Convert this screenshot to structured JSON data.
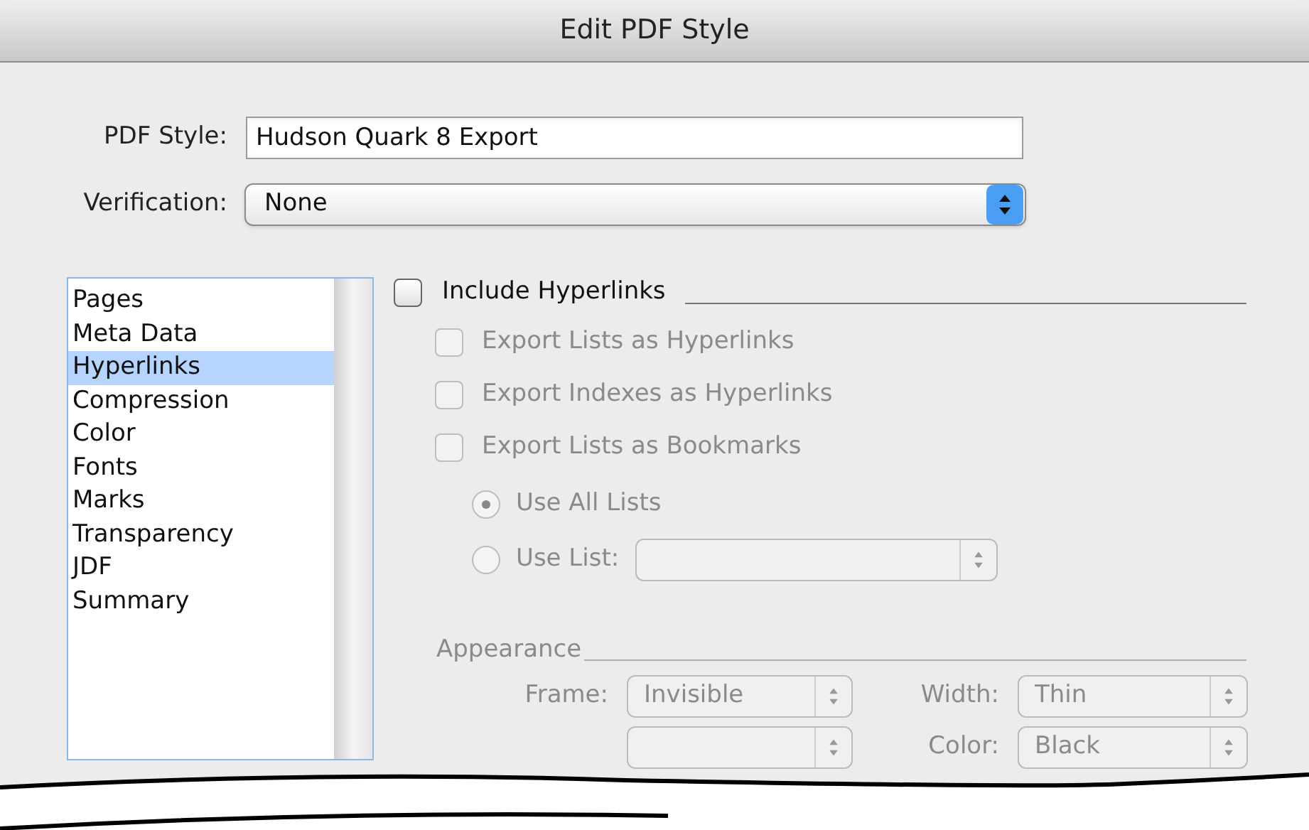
{
  "window": {
    "title": "Edit PDF Style"
  },
  "pdf_style": {
    "label": "PDF Style:",
    "value": "Hudson Quark 8 Export"
  },
  "verification": {
    "label": "Verification:",
    "value": "None"
  },
  "sidebar": {
    "items": [
      {
        "label": "Pages",
        "selected": false
      },
      {
        "label": "Meta Data",
        "selected": false
      },
      {
        "label": "Hyperlinks",
        "selected": true
      },
      {
        "label": "Compression",
        "selected": false
      },
      {
        "label": "Color",
        "selected": false
      },
      {
        "label": "Fonts",
        "selected": false
      },
      {
        "label": "Marks",
        "selected": false
      },
      {
        "label": "Transparency",
        "selected": false
      },
      {
        "label": "JDF",
        "selected": false
      },
      {
        "label": "Summary",
        "selected": false
      }
    ]
  },
  "include_hyperlinks": {
    "label": "Include Hyperlinks",
    "checked": false
  },
  "options": [
    {
      "label": "Export Lists as Hyperlinks",
      "checked": false,
      "disabled": true
    },
    {
      "label": "Export Indexes as Hyperlinks",
      "checked": false,
      "disabled": true
    },
    {
      "label": "Export Lists as Bookmarks",
      "checked": false,
      "disabled": true
    }
  ],
  "list_choice": [
    {
      "label": "Use All Lists",
      "selected": true,
      "disabled": true
    },
    {
      "label": "Use List:",
      "selected": false,
      "disabled": true
    }
  ],
  "appearance": {
    "title": "Appearance",
    "rows": [
      {
        "left_label": "Frame:",
        "left_value": "Invisible",
        "right_label": "Width:",
        "right_value": "Thin"
      },
      {
        "right_label": "Color:",
        "right_value": "Black"
      }
    ]
  }
}
